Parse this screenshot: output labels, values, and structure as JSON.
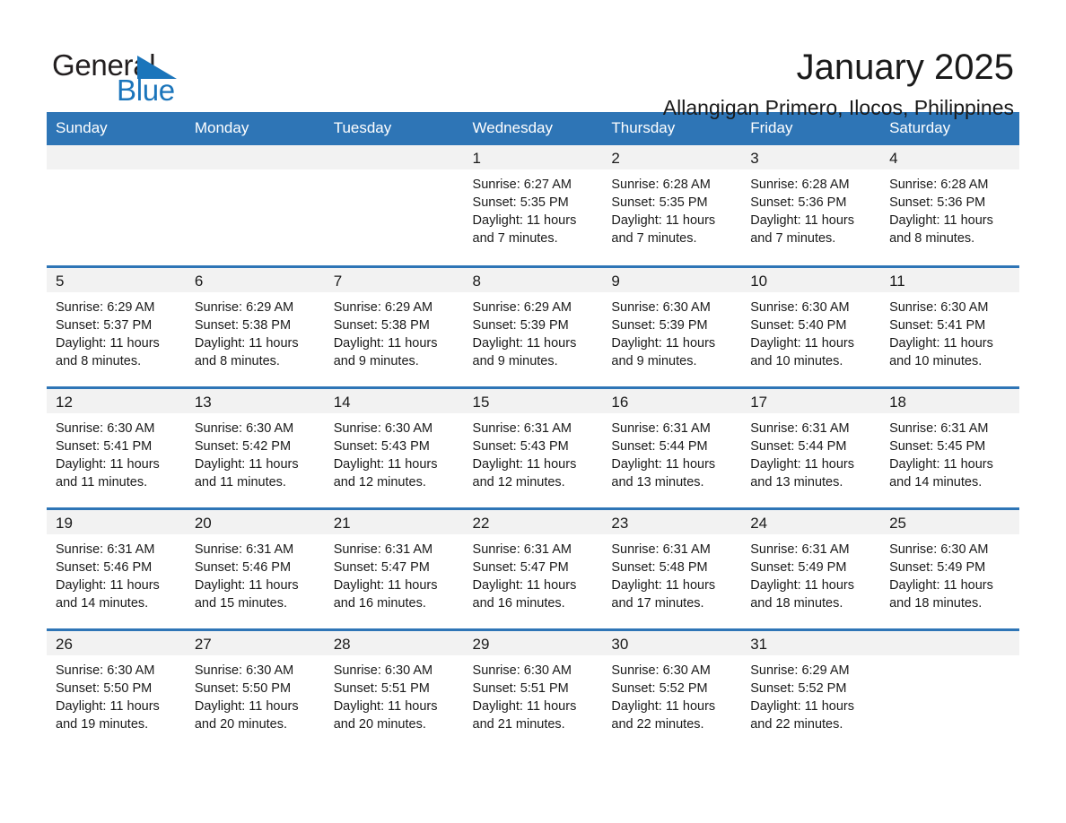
{
  "brand": {
    "name_part1": "General",
    "name_part2": "Blue",
    "triangle_icon": "triangle-icon",
    "accent_color": "#1b75bb"
  },
  "header": {
    "month_title": "January 2025",
    "location": "Allangigan Primero, Ilocos, Philippines"
  },
  "calendar": {
    "header_bg": "#2e75b6",
    "daynum_bg": "#f2f2f2",
    "weekday_headers": [
      "Sunday",
      "Monday",
      "Tuesday",
      "Wednesday",
      "Thursday",
      "Friday",
      "Saturday"
    ],
    "weeks": [
      [
        {
          "day": "",
          "lines": []
        },
        {
          "day": "",
          "lines": []
        },
        {
          "day": "",
          "lines": []
        },
        {
          "day": "1",
          "lines": [
            "Sunrise: 6:27 AM",
            "Sunset: 5:35 PM",
            "Daylight: 11 hours",
            "and 7 minutes."
          ]
        },
        {
          "day": "2",
          "lines": [
            "Sunrise: 6:28 AM",
            "Sunset: 5:35 PM",
            "Daylight: 11 hours",
            "and 7 minutes."
          ]
        },
        {
          "day": "3",
          "lines": [
            "Sunrise: 6:28 AM",
            "Sunset: 5:36 PM",
            "Daylight: 11 hours",
            "and 7 minutes."
          ]
        },
        {
          "day": "4",
          "lines": [
            "Sunrise: 6:28 AM",
            "Sunset: 5:36 PM",
            "Daylight: 11 hours",
            "and 8 minutes."
          ]
        }
      ],
      [
        {
          "day": "5",
          "lines": [
            "Sunrise: 6:29 AM",
            "Sunset: 5:37 PM",
            "Daylight: 11 hours",
            "and 8 minutes."
          ]
        },
        {
          "day": "6",
          "lines": [
            "Sunrise: 6:29 AM",
            "Sunset: 5:38 PM",
            "Daylight: 11 hours",
            "and 8 minutes."
          ]
        },
        {
          "day": "7",
          "lines": [
            "Sunrise: 6:29 AM",
            "Sunset: 5:38 PM",
            "Daylight: 11 hours",
            "and 9 minutes."
          ]
        },
        {
          "day": "8",
          "lines": [
            "Sunrise: 6:29 AM",
            "Sunset: 5:39 PM",
            "Daylight: 11 hours",
            "and 9 minutes."
          ]
        },
        {
          "day": "9",
          "lines": [
            "Sunrise: 6:30 AM",
            "Sunset: 5:39 PM",
            "Daylight: 11 hours",
            "and 9 minutes."
          ]
        },
        {
          "day": "10",
          "lines": [
            "Sunrise: 6:30 AM",
            "Sunset: 5:40 PM",
            "Daylight: 11 hours",
            "and 10 minutes."
          ]
        },
        {
          "day": "11",
          "lines": [
            "Sunrise: 6:30 AM",
            "Sunset: 5:41 PM",
            "Daylight: 11 hours",
            "and 10 minutes."
          ]
        }
      ],
      [
        {
          "day": "12",
          "lines": [
            "Sunrise: 6:30 AM",
            "Sunset: 5:41 PM",
            "Daylight: 11 hours",
            "and 11 minutes."
          ]
        },
        {
          "day": "13",
          "lines": [
            "Sunrise: 6:30 AM",
            "Sunset: 5:42 PM",
            "Daylight: 11 hours",
            "and 11 minutes."
          ]
        },
        {
          "day": "14",
          "lines": [
            "Sunrise: 6:30 AM",
            "Sunset: 5:43 PM",
            "Daylight: 11 hours",
            "and 12 minutes."
          ]
        },
        {
          "day": "15",
          "lines": [
            "Sunrise: 6:31 AM",
            "Sunset: 5:43 PM",
            "Daylight: 11 hours",
            "and 12 minutes."
          ]
        },
        {
          "day": "16",
          "lines": [
            "Sunrise: 6:31 AM",
            "Sunset: 5:44 PM",
            "Daylight: 11 hours",
            "and 13 minutes."
          ]
        },
        {
          "day": "17",
          "lines": [
            "Sunrise: 6:31 AM",
            "Sunset: 5:44 PM",
            "Daylight: 11 hours",
            "and 13 minutes."
          ]
        },
        {
          "day": "18",
          "lines": [
            "Sunrise: 6:31 AM",
            "Sunset: 5:45 PM",
            "Daylight: 11 hours",
            "and 14 minutes."
          ]
        }
      ],
      [
        {
          "day": "19",
          "lines": [
            "Sunrise: 6:31 AM",
            "Sunset: 5:46 PM",
            "Daylight: 11 hours",
            "and 14 minutes."
          ]
        },
        {
          "day": "20",
          "lines": [
            "Sunrise: 6:31 AM",
            "Sunset: 5:46 PM",
            "Daylight: 11 hours",
            "and 15 minutes."
          ]
        },
        {
          "day": "21",
          "lines": [
            "Sunrise: 6:31 AM",
            "Sunset: 5:47 PM",
            "Daylight: 11 hours",
            "and 16 minutes."
          ]
        },
        {
          "day": "22",
          "lines": [
            "Sunrise: 6:31 AM",
            "Sunset: 5:47 PM",
            "Daylight: 11 hours",
            "and 16 minutes."
          ]
        },
        {
          "day": "23",
          "lines": [
            "Sunrise: 6:31 AM",
            "Sunset: 5:48 PM",
            "Daylight: 11 hours",
            "and 17 minutes."
          ]
        },
        {
          "day": "24",
          "lines": [
            "Sunrise: 6:31 AM",
            "Sunset: 5:49 PM",
            "Daylight: 11 hours",
            "and 18 minutes."
          ]
        },
        {
          "day": "25",
          "lines": [
            "Sunrise: 6:30 AM",
            "Sunset: 5:49 PM",
            "Daylight: 11 hours",
            "and 18 minutes."
          ]
        }
      ],
      [
        {
          "day": "26",
          "lines": [
            "Sunrise: 6:30 AM",
            "Sunset: 5:50 PM",
            "Daylight: 11 hours",
            "and 19 minutes."
          ]
        },
        {
          "day": "27",
          "lines": [
            "Sunrise: 6:30 AM",
            "Sunset: 5:50 PM",
            "Daylight: 11 hours",
            "and 20 minutes."
          ]
        },
        {
          "day": "28",
          "lines": [
            "Sunrise: 6:30 AM",
            "Sunset: 5:51 PM",
            "Daylight: 11 hours",
            "and 20 minutes."
          ]
        },
        {
          "day": "29",
          "lines": [
            "Sunrise: 6:30 AM",
            "Sunset: 5:51 PM",
            "Daylight: 11 hours",
            "and 21 minutes."
          ]
        },
        {
          "day": "30",
          "lines": [
            "Sunrise: 6:30 AM",
            "Sunset: 5:52 PM",
            "Daylight: 11 hours",
            "and 22 minutes."
          ]
        },
        {
          "day": "31",
          "lines": [
            "Sunrise: 6:29 AM",
            "Sunset: 5:52 PM",
            "Daylight: 11 hours",
            "and 22 minutes."
          ]
        },
        {
          "day": "",
          "lines": []
        }
      ]
    ]
  }
}
